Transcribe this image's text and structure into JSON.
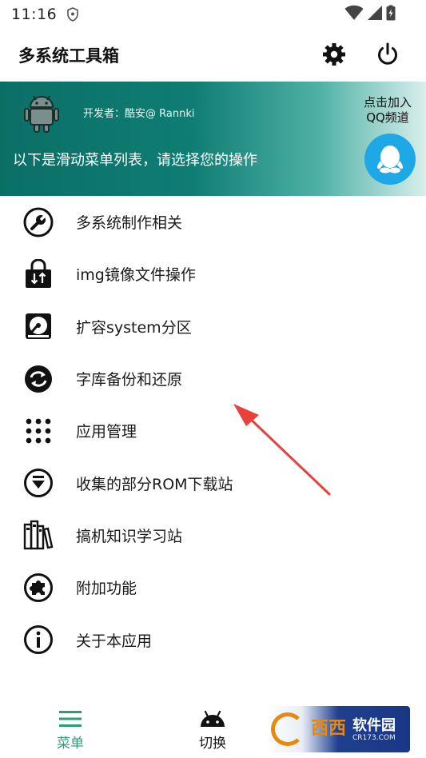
{
  "status_bar": {
    "time": "11:16"
  },
  "app_bar": {
    "title": "多系统工具箱",
    "settings_icon": "gear-icon",
    "power_icon": "power-icon"
  },
  "banner": {
    "developer": "开发者：酷安@ Rannki",
    "message": "以下是滑动菜单列表，请选择您的操作",
    "join_line1": "点击加入",
    "join_line2": "QQ频道",
    "colors": {
      "start": "#0b6f66",
      "end": "#d9efec",
      "qq": "#1fa8e6"
    }
  },
  "menu": {
    "items": [
      {
        "label": "多系统制作相关",
        "icon": "wrench-icon"
      },
      {
        "label": "img镜像文件操作",
        "icon": "image-file-icon"
      },
      {
        "label": "扩容system分区",
        "icon": "hard-disk-icon"
      },
      {
        "label": "字库备份和还原",
        "icon": "restore-icon"
      },
      {
        "label": "应用管理",
        "icon": "apps-grid-icon"
      },
      {
        "label": "收集的部分ROM下载站",
        "icon": "download-icon"
      },
      {
        "label": "搞机知识学习站",
        "icon": "books-icon"
      },
      {
        "label": "附加功能",
        "icon": "puzzle-icon"
      },
      {
        "label": "关于本应用",
        "icon": "info-icon"
      }
    ]
  },
  "bottom_nav": {
    "items": [
      {
        "label": "菜单",
        "icon": "menu-icon",
        "active": true
      },
      {
        "label": "切换",
        "icon": "android-icon",
        "active": false
      },
      {
        "label": "",
        "icon": "eye-icon",
        "active": false
      }
    ],
    "active_color": "#2e9d73"
  },
  "watermark": {
    "brand": "西西",
    "text": "软件园",
    "domain": "CR173.COM"
  },
  "annotation": {
    "arrow_color": "#e8413c"
  }
}
